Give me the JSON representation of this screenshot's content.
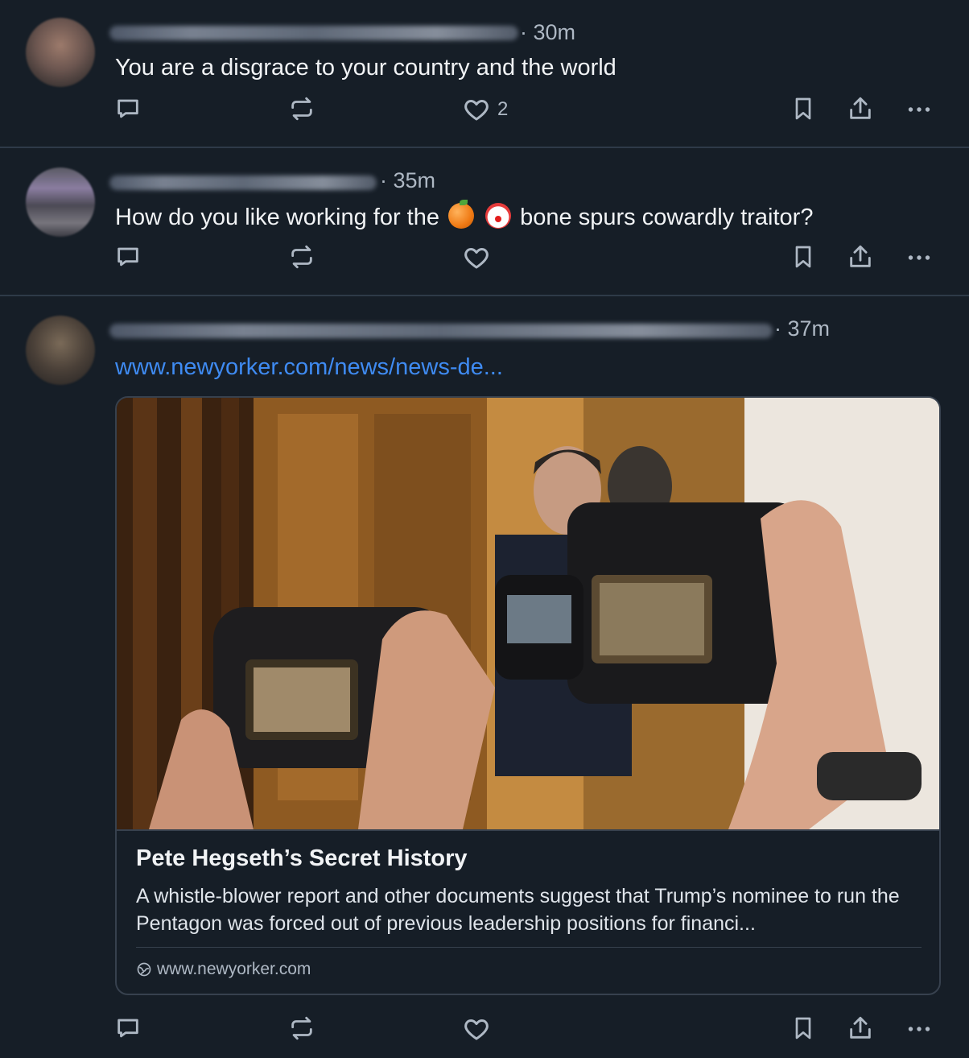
{
  "posts": [
    {
      "time": "· 30m",
      "text": "You are a disgrace to your country and the world",
      "likes": "2"
    },
    {
      "time": "· 35m",
      "text_before": "How do you like working for the",
      "emojis": [
        "orange-emoji",
        "clown-emoji"
      ],
      "text_after": "bone spurs cowardly traitor?",
      "likes": ""
    },
    {
      "time": "· 37m",
      "link_text": "www.newyorker.com/news/news-de...",
      "card": {
        "image": "photographers-with-cameras-at-elevator",
        "title": "Pete Hegseth’s Secret History",
        "description": "A whistle-blower report and other documents suggest that Trump’s nominee to run the Pentagon was forced out of previous leadership positions for financi...",
        "domain": "www.newyorker.com"
      },
      "likes": ""
    }
  ],
  "icons": [
    "reply-icon",
    "repost-icon",
    "heart-icon",
    "bookmark-icon",
    "share-icon",
    "more-icon",
    "globe-icon"
  ]
}
